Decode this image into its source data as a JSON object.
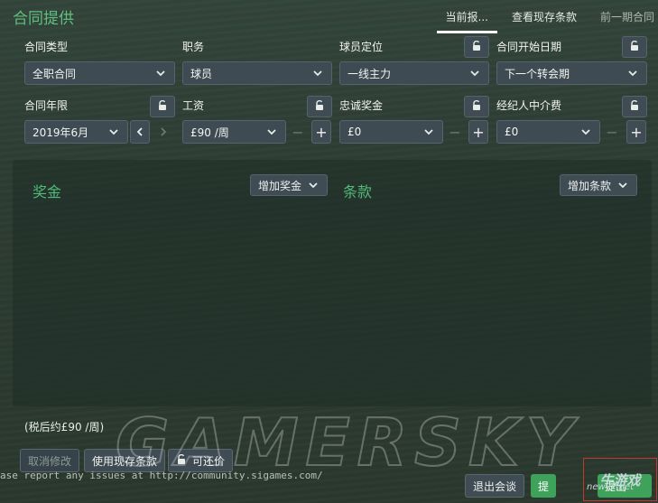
{
  "header": {
    "title": "合同提供",
    "tabs": [
      "当前报...",
      "查看现存条款",
      "前一期合同"
    ]
  },
  "fields": {
    "contract_type": {
      "label": "合同类型",
      "value": "全职合同"
    },
    "role": {
      "label": "职务",
      "value": "球员"
    },
    "squad_status": {
      "label": "球员定位",
      "value": "一线主力"
    },
    "start_date": {
      "label": "合同开始日期",
      "value": "下一个转会期"
    },
    "length": {
      "label": "合同年限",
      "value": "2019年6月"
    },
    "wage": {
      "label": "工资",
      "value": "£90 /周"
    },
    "loyalty_bonus": {
      "label": "忠诚奖金",
      "value": "£0"
    },
    "agent_fee": {
      "label": "经纪人中介费",
      "value": "£0"
    }
  },
  "bonuses": {
    "title": "奖金",
    "add_label": "增加奖金"
  },
  "clauses": {
    "title": "条款",
    "add_label": "增加条款"
  },
  "tax_note": "(税后约£90 /周)",
  "actions": {
    "undo": "取消修改",
    "use_existing": "使用现存条款",
    "negotiable": "可还价",
    "leave": "退出会谈",
    "partial": "提",
    "propose": "提出"
  },
  "status_bar": "ase report any issues at http://community.sigames.com/",
  "watermark": "GAMERSKY",
  "logo": {
    "main": "牛游戏",
    "sub": "newyx.net"
  },
  "colors": {
    "accent": "#5fbf7f",
    "button": "#3f4c54",
    "confirm": "#3fa25b"
  }
}
